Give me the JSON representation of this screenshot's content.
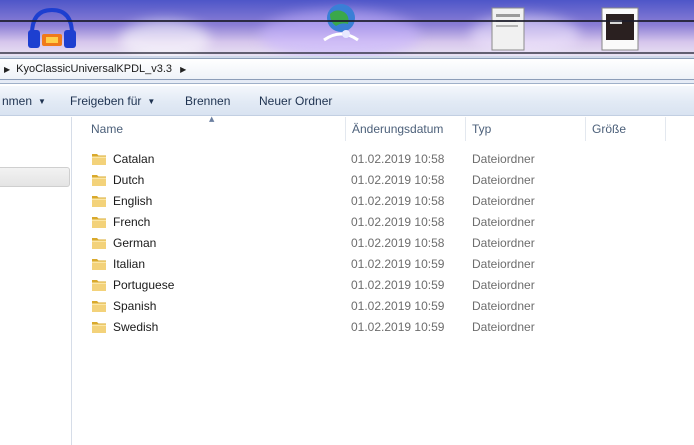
{
  "address": {
    "segments": [
      "KyoClassicUniversalKPDL_v3.3"
    ]
  },
  "toolbar": {
    "organize_label": "nmen",
    "share_label": "Freigeben für",
    "burn_label": "Brennen",
    "new_folder_label": "Neuer Ordner"
  },
  "columns": {
    "name": "Name",
    "date": "Änderungsdatum",
    "type": "Typ",
    "size": "Größe"
  },
  "files": [
    {
      "name": "Catalan",
      "date": "01.02.2019 10:58",
      "type": "Dateiordner"
    },
    {
      "name": "Dutch",
      "date": "01.02.2019 10:58",
      "type": "Dateiordner"
    },
    {
      "name": "English",
      "date": "01.02.2019 10:58",
      "type": "Dateiordner"
    },
    {
      "name": "French",
      "date": "01.02.2019 10:58",
      "type": "Dateiordner"
    },
    {
      "name": "German",
      "date": "01.02.2019 10:58",
      "type": "Dateiordner"
    },
    {
      "name": "Italian",
      "date": "01.02.2019 10:59",
      "type": "Dateiordner"
    },
    {
      "name": "Portuguese",
      "date": "01.02.2019 10:59",
      "type": "Dateiordner"
    },
    {
      "name": "Spanish",
      "date": "01.02.2019 10:59",
      "type": "Dateiordner"
    },
    {
      "name": "Swedish",
      "date": "01.02.2019 10:59",
      "type": "Dateiordner"
    }
  ],
  "colors": {
    "folder": "#e8c25a",
    "toolbar_text": "#1e3250",
    "header_text": "#4c607a"
  }
}
